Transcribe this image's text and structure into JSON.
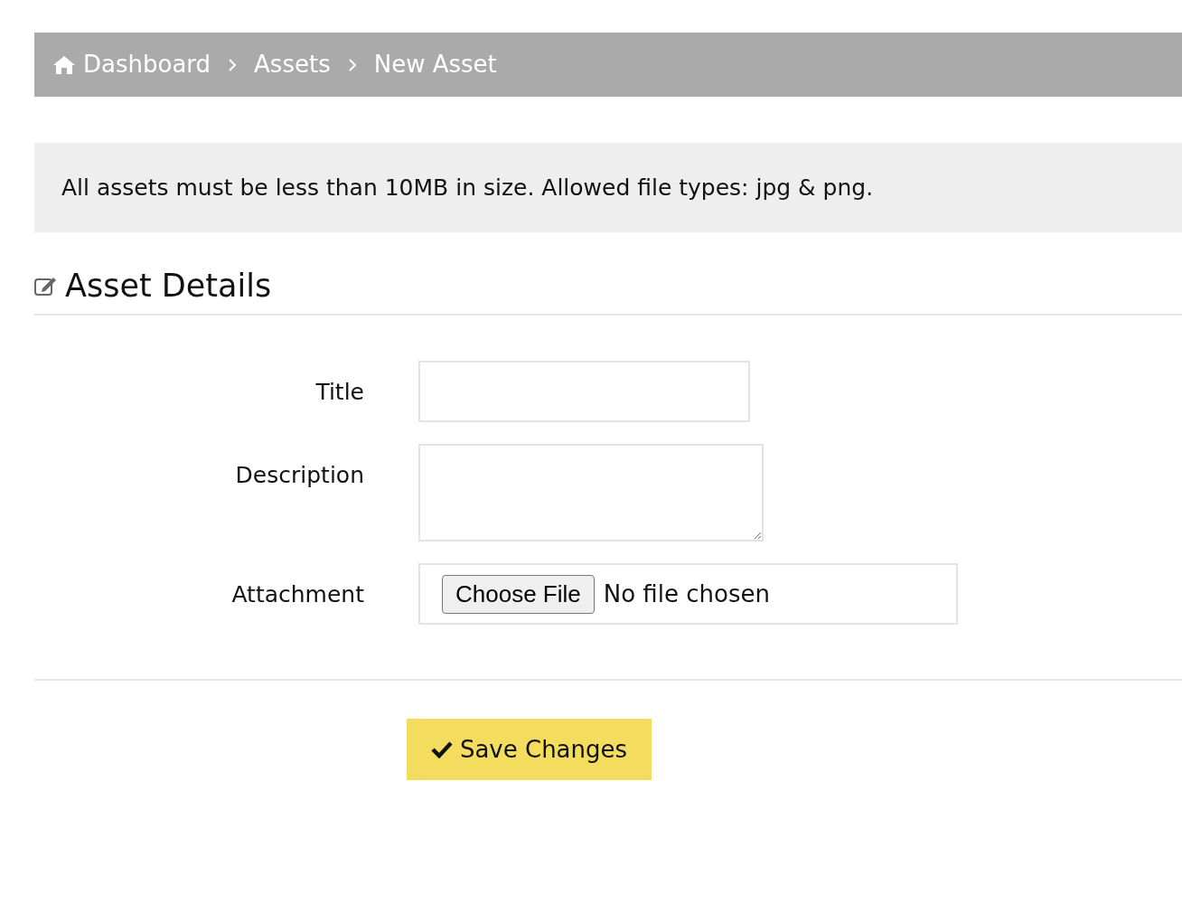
{
  "breadcrumb": [
    {
      "label": "Dashboard"
    },
    {
      "label": "Assets"
    },
    {
      "label": "New Asset"
    }
  ],
  "alert": "All assets must be less than 10MB in size. Allowed file types: jpg & png.",
  "section": {
    "title": "Asset Details"
  },
  "fields": [
    {
      "label": "Title",
      "kind": "text"
    },
    {
      "label": "Description",
      "kind": "textarea"
    },
    {
      "label": "Attachment",
      "kind": "file",
      "button": "Choose File",
      "status": "No file chosen"
    }
  ],
  "submit": {
    "label": "Save Changes"
  }
}
